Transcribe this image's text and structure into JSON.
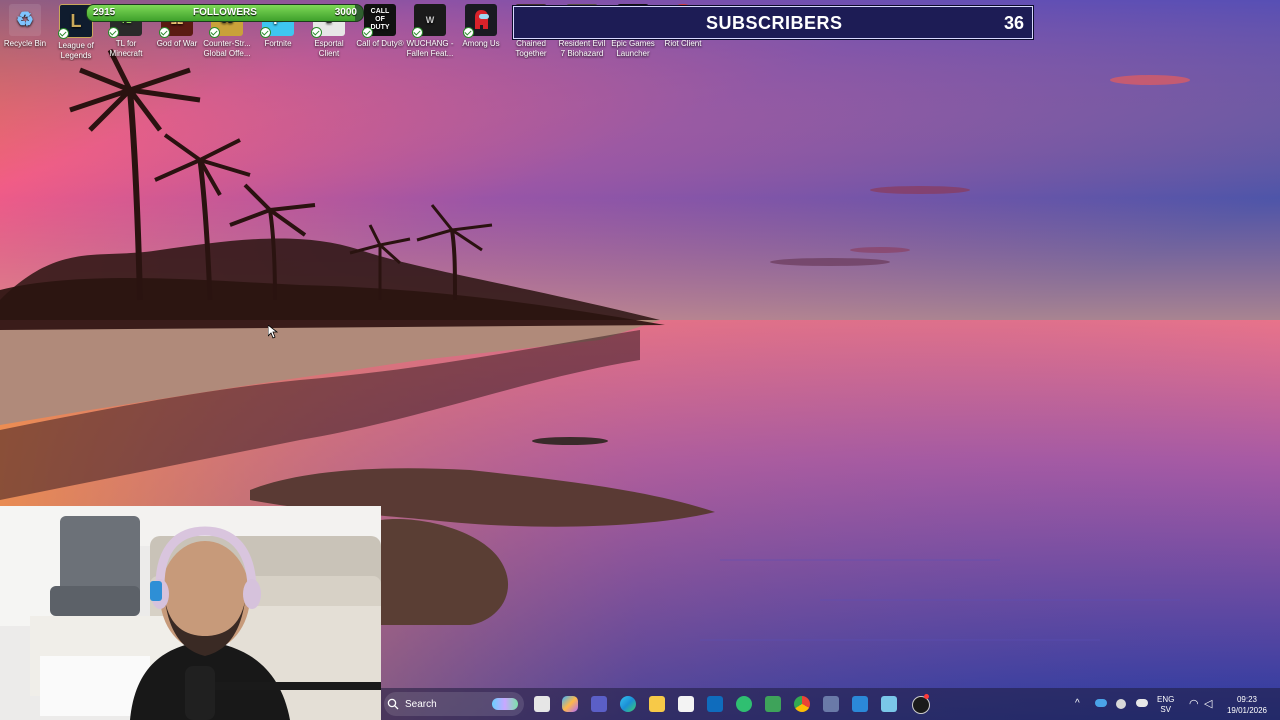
{
  "desktop": {
    "icons": [
      {
        "label": "Recycle Bin",
        "icon": "recycle-bin-icon",
        "color": "#3a78b8",
        "glyph": "♻"
      },
      {
        "label": "League of Legends",
        "icon": "league-of-legends-icon",
        "color": "#0f1c2e",
        "glyph": "L"
      },
      {
        "label": "TL for Minecraft Launch...",
        "icon": "tlauncher-icon",
        "color": "#2a2a2a",
        "glyph": "TL"
      },
      {
        "label": "God of War",
        "icon": "god-of-war-icon",
        "color": "#5a1a12",
        "glyph": "Ω"
      },
      {
        "label": "Counter-Str... Global Offe...",
        "icon": "counter-strike-icon",
        "color": "#c9a13a",
        "glyph": "CS"
      },
      {
        "label": "Fortnite",
        "icon": "fortnite-icon",
        "color": "#3ec6f0",
        "glyph": "F"
      },
      {
        "label": "Esportal Client",
        "icon": "esportal-icon",
        "color": "#e7e7e7",
        "glyph": "E"
      },
      {
        "label": "Call of Duty®",
        "icon": "call-of-duty-icon",
        "color": "#111111",
        "glyph": "CALL OF DUTY"
      },
      {
        "label": "WUCHANG - Fallen Feat...",
        "icon": "wuchang-icon",
        "color": "#1a1a1a",
        "glyph": "W"
      },
      {
        "label": "Among Us",
        "icon": "among-us-icon",
        "color": "#1a1a22",
        "glyph": "◉"
      },
      {
        "label": "Chained Together",
        "icon": "chained-together-icon",
        "color": "#40302a",
        "glyph": "0"
      },
      {
        "label": "Resident Evil 7 Biohazard",
        "icon": "resident-evil-icon",
        "color": "#554e40",
        "glyph": "RE"
      },
      {
        "label": "Epic Games Launcher",
        "icon": "epic-games-icon",
        "color": "#111111",
        "glyph": "EPIC GAMES"
      },
      {
        "label": "Riot Client",
        "icon": "riot-client-icon",
        "color": "#d13639",
        "glyph": "✊"
      }
    ]
  },
  "overlay": {
    "followers": {
      "label": "FOLLOWERS",
      "current": "2915",
      "goal": "3000",
      "progress": 0.97,
      "color": "#5cc43e"
    },
    "subscribers": {
      "label": "SUBSCRIBERS",
      "count": "36",
      "bg": "#1d1c55"
    }
  },
  "taskbar": {
    "search_placeholder": "Search",
    "apps": [
      "widgets-icon",
      "task-view-icon",
      "copilot-icon",
      "teams-icon",
      "edge-icon",
      "file-explorer-icon",
      "store-icon",
      "outlook-icon",
      "vpn-icon",
      "discord-icon",
      "chrome-icon",
      "app-icon",
      "photos-icon",
      "snipping-icon",
      "obs-icon"
    ],
    "tray": {
      "language": "ENG",
      "layout": "SV",
      "time": "09:23",
      "date": "19/01/2026"
    }
  }
}
